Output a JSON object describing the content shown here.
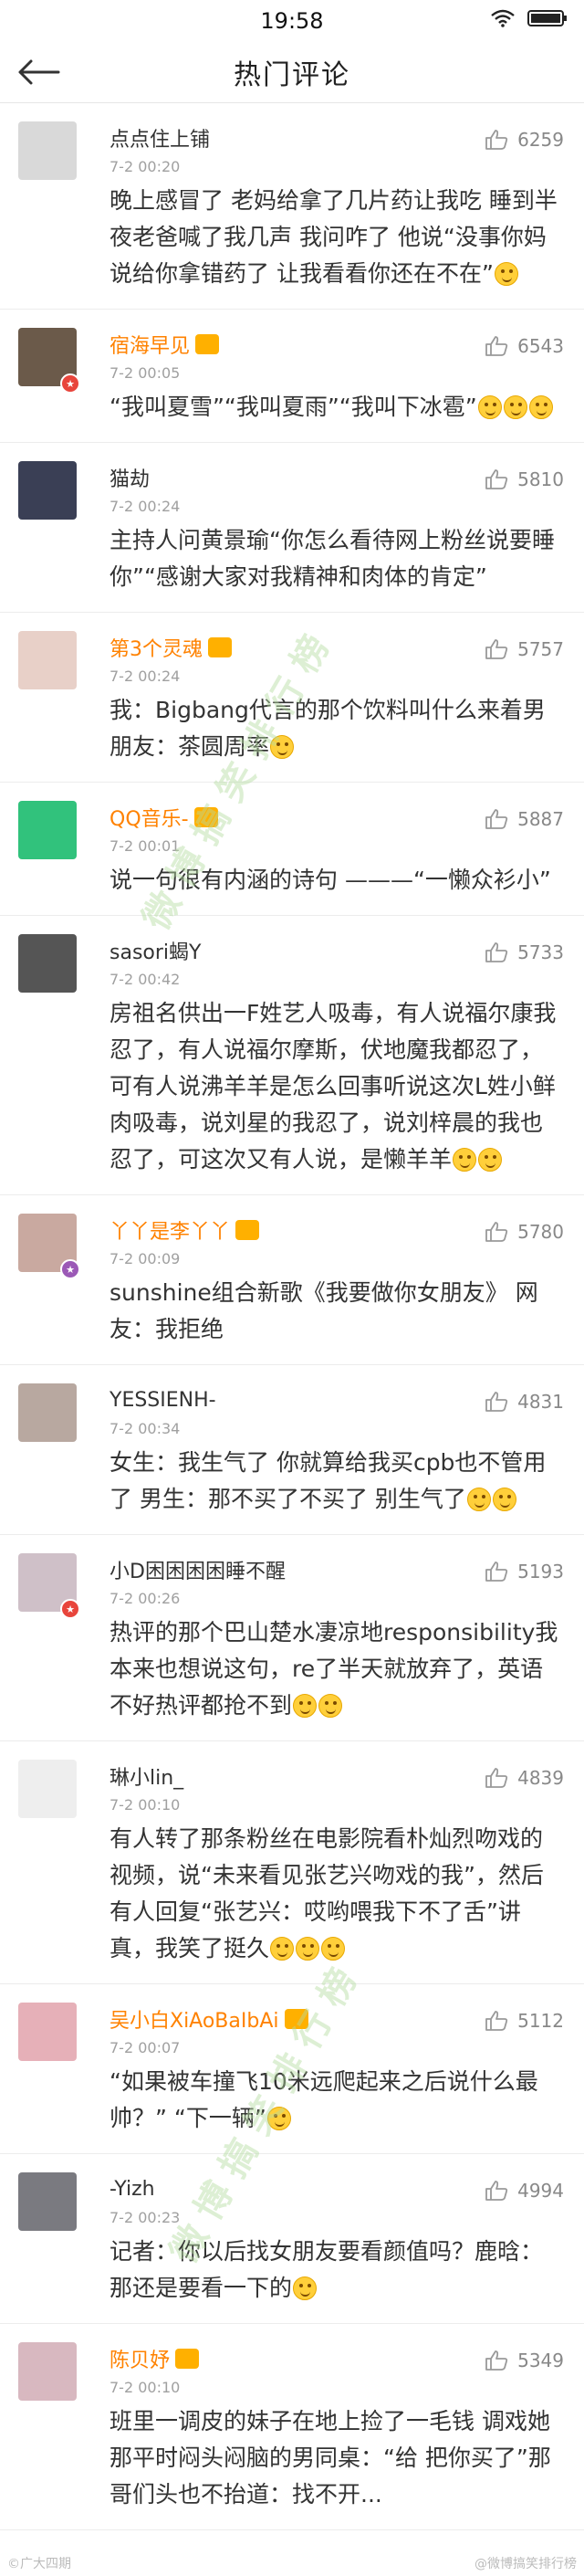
{
  "status": {
    "time": "19:58"
  },
  "header": {
    "title": "热门评论"
  },
  "comments": [
    {
      "name": "点点住上铺",
      "time": "7-2 00:20",
      "likes": "6259",
      "text": "晚上感冒了 老妈给拿了几片药让我吃 睡到半夜老爸喊了我几声 我问咋了 他说“没事你妈说给你拿错药了 让我看看你还在不在”",
      "emo": 1,
      "avatar_color": "#d9d9d9"
    },
    {
      "name": "宿海早见",
      "time": "7-2 00:05",
      "likes": "6543",
      "text": "“我叫夏雪”“我叫夏雨”“我叫下冰雹”",
      "emo": 3,
      "avatar_color": "#6b5a4a"
    },
    {
      "name": "猫劫",
      "time": "7-2 00:24",
      "likes": "5810",
      "text": "主持人问黄景瑜“你怎么看待网上粉丝说要睡你”“感谢大家对我精神和肉体的肯定”",
      "emo": 0,
      "avatar_color": "#3a3f55"
    },
    {
      "name": "第3个灵魂",
      "time": "7-2 00:24",
      "likes": "5757",
      "text": "我：Bigbang代言的那个饮料叫什么来着男朋友：茶圆周率",
      "emo": 1,
      "avatar_color": "#e8d0c8"
    },
    {
      "name": "QQ音乐-",
      "time": "7-2 00:01",
      "likes": "5887",
      "text": "说一句很有内涵的诗句 ———“一懒众衫小”",
      "emo": 0,
      "avatar_color": "#31c27c"
    },
    {
      "name": "sasori蝎Y",
      "time": "7-2 00:42",
      "likes": "5733",
      "text": "房祖名供出一F姓艺人吸毒，有人说福尔康我忍了，有人说福尔摩斯，伏地魔我都忍了，可有人说沸羊羊是怎么回事听说这次L姓小鲜肉吸毒，说刘星的我忍了，说刘梓晨的我也忍了，可这次又有人说，是懒羊羊",
      "emo": 2,
      "avatar_color": "#555555"
    },
    {
      "name": "丫丫是李丫丫",
      "time": "7-2 00:09",
      "likes": "5780",
      "text": "sunshine组合新歌《我要做你女朋友》 网友：我拒绝",
      "emo": 0,
      "avatar_color": "#c9a9a0"
    },
    {
      "name": "YESSIENH-",
      "time": "7-2 00:34",
      "likes": "4831",
      "text": "女生：我生气了 你就算给我买cpb也不管用了 男生：那不买了不买了 别生气了",
      "emo": 2,
      "avatar_color": "#b8a8a0"
    },
    {
      "name": "小D困困困困睡不醒",
      "time": "7-2 00:26",
      "likes": "5193",
      "text": "热评的那个巴山楚水凄凉地responsibility我本来也想说这句，re了半天就放弃了，英语不好热评都抢不到",
      "emo": 2,
      "avatar_color": "#cfc0c8"
    },
    {
      "name": "琳小lin_",
      "time": "7-2 00:10",
      "likes": "4839",
      "text": "有人转了那条粉丝在电影院看朴灿烈吻戏的视频，说“未来看见张艺兴吻戏的我”，然后有人回复“张艺兴：哎哟喂我下不了舌”讲真，我笑了挺久",
      "emo": 3,
      "avatar_color": "#eeeeee"
    },
    {
      "name": "吴小白XiAoBaIbAi",
      "time": "7-2 00:07",
      "likes": "5112",
      "text": "“如果被车撞飞10米远爬起来之后说什么最帅？” “下一辆”",
      "emo": 1,
      "avatar_color": "#e6b0b8"
    },
    {
      "name": "-Yizh",
      "time": "7-2 00:23",
      "likes": "4994",
      "text": "记者：你以后找女朋友要看颜值吗？鹿晗：那还是要看一下的",
      "emo": 1,
      "avatar_color": "#7a7a80"
    },
    {
      "name": "陈贝妤",
      "time": "7-2 00:10",
      "likes": "5349",
      "text": "班里一调皮的妹子在地上捡了一毛钱 调戏她那平时闷头闷脑的男同桌：“给 把你买了”那哥们头也不抬道：找不开...",
      "emo": 0,
      "avatar_color": "#d8b8c0"
    }
  ],
  "watermark": {
    "text1": "微博搞笑排行榜",
    "text2": "微博搞笑排行榜"
  },
  "footer": {
    "left": "©广大四期",
    "right": "@微博搞笑排行榜"
  }
}
